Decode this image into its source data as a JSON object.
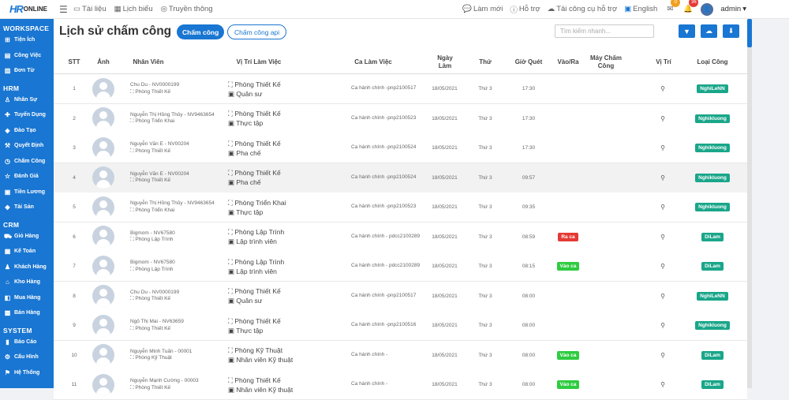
{
  "topbar": {
    "logo_hr": "HR",
    "logo_online": "ONLINE",
    "links": [
      {
        "icon": "document-icon",
        "label": "Tài liệu"
      },
      {
        "icon": "calendar-icon",
        "label": "Lịch biểu"
      },
      {
        "icon": "radio-icon",
        "label": "Truyền thông"
      }
    ],
    "right": [
      {
        "icon": "chat-icon",
        "label": "Làm mới"
      },
      {
        "icon": "help-icon",
        "label": "Hỗ trợ"
      },
      {
        "icon": "cloud-download-icon",
        "label": "Tải công cụ hỗ trợ"
      },
      {
        "icon": "translate-icon",
        "label": "English"
      }
    ],
    "message_badge": "0",
    "notification_badge": "36",
    "user": "admin"
  },
  "sidebar": {
    "sections": [
      {
        "title": "WORKSPACE",
        "items": [
          {
            "icon": "grid-icon",
            "label": "Tiện Ích"
          },
          {
            "icon": "briefcase-icon",
            "label": "Công Việc"
          },
          {
            "icon": "file-icon",
            "label": "Đơn Từ"
          }
        ]
      },
      {
        "title": "HRM",
        "items": [
          {
            "icon": "user-icon",
            "label": "Nhân Sự"
          },
          {
            "icon": "user-plus-icon",
            "label": "Tuyển Dụng"
          },
          {
            "icon": "book-icon",
            "label": "Đào Tạo"
          },
          {
            "icon": "gavel-icon",
            "label": "Quyết Định"
          },
          {
            "icon": "clock-icon",
            "label": "Chấm Công"
          },
          {
            "icon": "star-icon",
            "label": "Đánh Giá"
          },
          {
            "icon": "money-icon",
            "label": "Tiền Lương"
          },
          {
            "icon": "diamond-icon",
            "label": "Tài Sản"
          }
        ]
      },
      {
        "title": "CRM",
        "items": [
          {
            "icon": "cart-icon",
            "label": "Giỏ Hàng"
          },
          {
            "icon": "calculator-icon",
            "label": "Kế Toán"
          },
          {
            "icon": "users-icon",
            "label": "Khách Hàng"
          },
          {
            "icon": "warehouse-icon",
            "label": "Kho Hàng"
          },
          {
            "icon": "bag-icon",
            "label": "Mua Hàng"
          },
          {
            "icon": "store-icon",
            "label": "Bán Hàng"
          }
        ]
      },
      {
        "title": "SYSTEM",
        "items": [
          {
            "icon": "chart-icon",
            "label": "Báo Cáo"
          },
          {
            "icon": "settings-icon",
            "label": "Cấu Hình"
          },
          {
            "icon": "system-icon",
            "label": "Hệ Thống"
          }
        ]
      }
    ]
  },
  "page": {
    "title": "Lịch sử chấm công",
    "tab_active": "Chấm công",
    "tab_other": "Chấm công api",
    "search_placeholder": "Tìm kiếm nhanh..."
  },
  "table": {
    "headers": {
      "stt": "STT",
      "anh": "Ảnh",
      "nhan_vien": "Nhân Viên",
      "vi_tri": "Vị Trí Làm Việc",
      "ca": "Ca Làm Việc",
      "ngay": "Ngày Làm",
      "thu": "Thứ",
      "gio": "Giờ Quét",
      "vao_ra": "Vào/Ra",
      "may": "Máy Chấm Công",
      "vitri2": "Vị Trí",
      "loai": "Loại Công"
    },
    "rows": [
      {
        "stt": "1",
        "name": "Chu Du - NV0000199",
        "dept": "Phòng Thiết Kế",
        "vt_dept": "Phòng Thiết Kế",
        "vt_role": "Quân sư",
        "ca": "Ca hành chính -pnp2100517",
        "ngay": "18/05/2021",
        "thu": "Thứ 3",
        "gio": "17:30",
        "vaora": "",
        "loai": "NghiLeNN"
      },
      {
        "stt": "2",
        "name": "Nguyễn Thị Hồng Thủy - NV9463654",
        "dept": "Phòng Triển Khai",
        "vt_dept": "Phòng Thiết Kế",
        "vt_role": "Thực tập",
        "ca": "Ca hành chính -pnp2100523",
        "ngay": "18/05/2021",
        "thu": "Thứ 3",
        "gio": "17:30",
        "vaora": "",
        "loai": "Nghikluong"
      },
      {
        "stt": "3",
        "name": "Nguyễn Văn E - NV00204",
        "dept": "Phòng Thiết Kế",
        "vt_dept": "Phòng Thiết Kế",
        "vt_role": "Pha chế",
        "ca": "Ca hành chính -pnp2100524",
        "ngay": "18/05/2021",
        "thu": "Thứ 3",
        "gio": "17:30",
        "vaora": "",
        "loai": "Nghikluong"
      },
      {
        "stt": "4",
        "name": "Nguyễn Văn E - NV00204",
        "dept": "Phòng Thiết Kế",
        "vt_dept": "Phòng Thiết Kế",
        "vt_role": "Pha chế",
        "ca": "Ca hành chính -pnp2100524",
        "ngay": "18/05/2021",
        "thu": "Thứ 3",
        "gio": "09:57",
        "vaora": "",
        "loai": "Nghikluong"
      },
      {
        "stt": "5",
        "name": "Nguyễn Thị Hồng Thủy - NV9463654",
        "dept": "Phòng Triển Khai",
        "vt_dept": "Phòng Triển Khai",
        "vt_role": "Thực tập",
        "ca": "Ca hành chính -pnp2100523",
        "ngay": "18/05/2021",
        "thu": "Thứ 3",
        "gio": "09:35",
        "vaora": "",
        "loai": "Nghikluong"
      },
      {
        "stt": "6",
        "name": "Bigmom - NV67580",
        "dept": "Phòng Lập Trình",
        "vt_dept": "Phòng Lập Trình",
        "vt_role": "Lập trình viên",
        "ca": "Ca hành chính - pdcc2100289",
        "ngay": "18/05/2021",
        "thu": "Thứ 3",
        "gio": "08:59",
        "vaora": "Ra ca",
        "loai": "DiLam"
      },
      {
        "stt": "7",
        "name": "Bigmom - NV67580",
        "dept": "Phòng Lập Trình",
        "vt_dept": "Phòng Lập Trình",
        "vt_role": "Lập trình viên",
        "ca": "Ca hành chính - pdcc2100289",
        "ngay": "18/05/2021",
        "thu": "Thứ 3",
        "gio": "08:15",
        "vaora": "Vào ca",
        "loai": "DiLam"
      },
      {
        "stt": "8",
        "name": "Chu Du - NV0000199",
        "dept": "Phòng Thiết Kế",
        "vt_dept": "Phòng Thiết Kế",
        "vt_role": "Quân sư",
        "ca": "Ca hành chính -pnp2100517",
        "ngay": "18/05/2021",
        "thu": "Thứ 3",
        "gio": "08:00",
        "vaora": "",
        "loai": "NghiLeNN"
      },
      {
        "stt": "9",
        "name": "Ngô Thị Mai - NV63659",
        "dept": "Phòng Thiết Kế",
        "vt_dept": "Phòng Thiết Kế",
        "vt_role": "Thực tập",
        "ca": "Ca hành chính -pnp2100516",
        "ngay": "18/05/2021",
        "thu": "Thứ 3",
        "gio": "08:00",
        "vaora": "",
        "loai": "Nghikluong"
      },
      {
        "stt": "10",
        "name": "Nguyễn Minh Tuấn - 00001",
        "dept": "Phòng Kỹ Thuật",
        "vt_dept": "Phòng Kỹ Thuật",
        "vt_role": "Nhân viên Kỹ thuật",
        "ca": "Ca hành chính -",
        "ngay": "18/05/2021",
        "thu": "Thứ 3",
        "gio": "08:00",
        "vaora": "Vào ca",
        "loai": "DiLam"
      },
      {
        "stt": "11",
        "name": "Nguyễn Mạnh Cường - 00003",
        "dept": "Phòng Thiết Kế",
        "vt_dept": "Phòng Thiết Kế",
        "vt_role": "Nhân viên Kỹ thuật",
        "ca": "Ca hành chính -",
        "ngay": "18/05/2021",
        "thu": "Thứ 3",
        "gio": "08:00",
        "vaora": "Vào ca",
        "loai": "DiLam"
      }
    ]
  },
  "colors": {
    "primary": "#1976d2",
    "tag_green": "#1aa68a",
    "vao": "#2ecc40",
    "ra": "#e53935",
    "orange_badge": "#f0a020",
    "red_badge": "#e53935"
  }
}
